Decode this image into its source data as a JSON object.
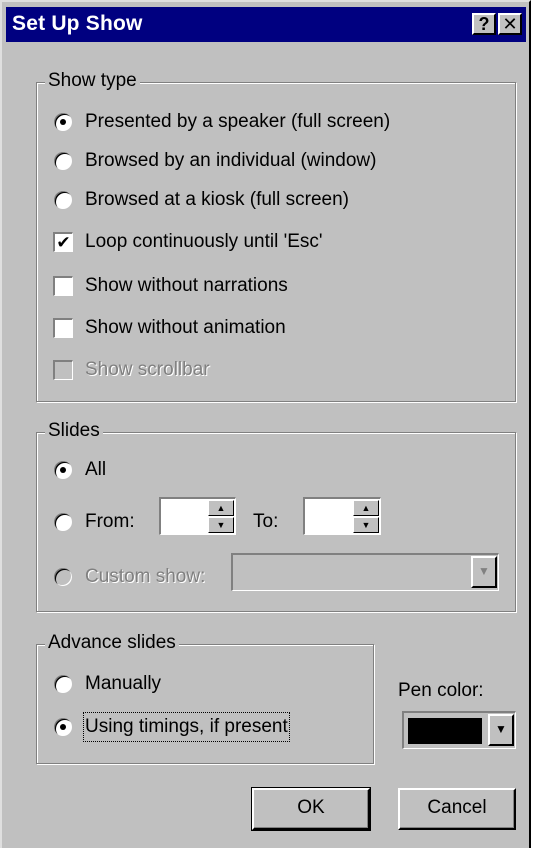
{
  "window": {
    "title": "Set Up Show",
    "help_glyph": "?",
    "close_glyph": "✕"
  },
  "show_type": {
    "legend": "Show type",
    "options": [
      {
        "label": "Presented by a speaker (full screen)",
        "checked": true
      },
      {
        "label": "Browsed by an individual (window)",
        "checked": false
      },
      {
        "label": "Browsed at a kiosk (full screen)",
        "checked": false
      }
    ],
    "checkboxes": [
      {
        "label": "Loop continuously until 'Esc'",
        "checked": true,
        "enabled": true
      },
      {
        "label": "Show without narrations",
        "checked": false,
        "enabled": true
      },
      {
        "label": "Show without animation",
        "checked": false,
        "enabled": true
      },
      {
        "label": "Show scrollbar",
        "checked": false,
        "enabled": false
      }
    ]
  },
  "slides": {
    "legend": "Slides",
    "all_label": "All",
    "from_label": "From:",
    "to_label": "To:",
    "from_value": "",
    "to_value": "",
    "custom_show_label": "Custom show:",
    "custom_show_value": "",
    "selected": "All"
  },
  "advance": {
    "legend": "Advance slides",
    "manually_label": "Manually",
    "timings_label": "Using timings, if present",
    "selected": "Using timings, if present"
  },
  "pen": {
    "label": "Pen color:",
    "color": "#000000"
  },
  "buttons": {
    "ok": "OK",
    "cancel": "Cancel"
  },
  "icons": {
    "checkmark": "✔",
    "spin_up": "▲",
    "spin_down": "▼",
    "dropdown": "▼"
  }
}
